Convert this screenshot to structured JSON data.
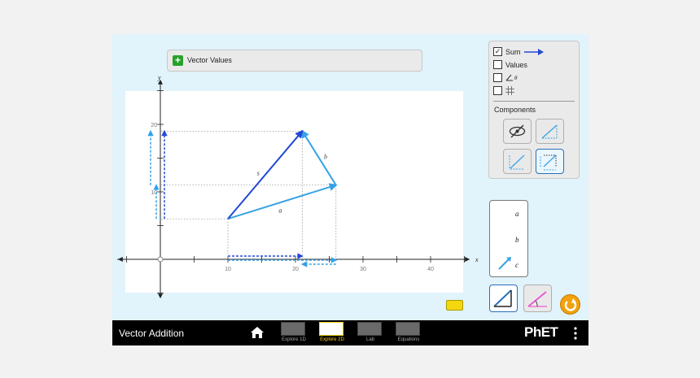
{
  "vector_values_panel": {
    "title": "Vector Values",
    "expand_symbol": "+"
  },
  "graph": {
    "x_axis_label": "x",
    "y_axis_label": "y",
    "x_ticks": [
      "10",
      "20",
      "30",
      "40"
    ],
    "y_ticks": [
      "10",
      "20"
    ],
    "vectors": [
      {
        "name": "a",
        "label": "a",
        "tail": [
          10,
          6
        ],
        "tip": [
          26,
          11
        ],
        "color": "#36a2e6"
      },
      {
        "name": "b",
        "label": "b",
        "tail": [
          26,
          11
        ],
        "tip": [
          21,
          19
        ],
        "color": "#36a2e6"
      },
      {
        "name": "s",
        "label": "s",
        "tail": [
          10,
          6
        ],
        "tip": [
          21,
          19
        ],
        "color": "#2249d8",
        "is_sum": true
      }
    ]
  },
  "controls": {
    "sum_label": "Sum",
    "sum_checked": true,
    "values_label": "Values",
    "values_checked": false,
    "angle_label": "θ",
    "angle_checked": false,
    "grid_checked": false,
    "components_label": "Components",
    "selected_component_mode": "projection"
  },
  "toolbox": {
    "labels": [
      "a",
      "b",
      "c"
    ]
  },
  "navbar": {
    "sim_title": "Vector Addition",
    "tabs": [
      "Explore 1D",
      "Explore 2D",
      "Lab",
      "Equations"
    ],
    "active_tab": "Explore 2D",
    "brand": "PhET"
  },
  "colors": {
    "blue": "#36a2e6",
    "sum_blue": "#2249d8",
    "background": "#e1f3fb",
    "active_tab": "#f6d014",
    "reset": "#f2a20c"
  }
}
